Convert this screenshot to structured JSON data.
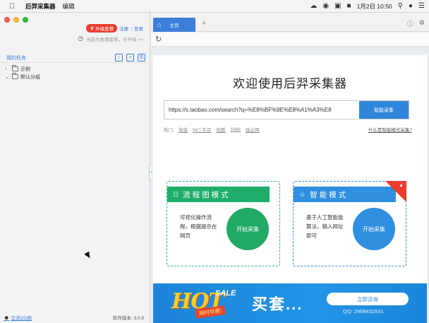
{
  "menubar": {
    "app_name": "后羿采集器",
    "menu_edit": "编辑",
    "clock": "1月2日 10:50"
  },
  "sidebar": {
    "upgrade_label": "升级套餐",
    "register_label": "注册",
    "separator": "|",
    "login_label": "登录",
    "package_notice": "当前为免费套餐，去升级 >>",
    "tasks_title": "我的任务",
    "tree": [
      {
        "label": "示例",
        "expanded": false
      },
      {
        "label": "默认分组",
        "expanded": true
      }
    ],
    "qq_group": "交流QQ群",
    "version": "软件版本: 3.0.9"
  },
  "tabs": {
    "home_label": "主页"
  },
  "main": {
    "welcome": "欢迎使用后羿采集器",
    "url_value": "https://s.taobao.com/search?q=%E8%BF%9E%E8%A1%A3%E8",
    "smart_collect_button": "智能采集",
    "hot_label": "热门:",
    "hot_links": [
      "淘宝",
      "58二手房",
      "优酷",
      "1688",
      "猎企网"
    ],
    "what_is_smart": "什么是智能模式采集?",
    "card_flow": {
      "title": "流程图模式",
      "description": "可视化操作流程，根据提示在网页",
      "start_label": "开始采集"
    },
    "card_smart": {
      "title": "智能模式",
      "description": "基于人工智能能算法，输入网址即可",
      "start_label": "开始采集"
    },
    "banner": {
      "hot_text": "HOT",
      "sale_text": "SALE",
      "limit_text": "限时特惠!",
      "buy_text": "买套...",
      "consult_label": "立即咨询",
      "qq_text": "QQ: 2968432931"
    }
  }
}
